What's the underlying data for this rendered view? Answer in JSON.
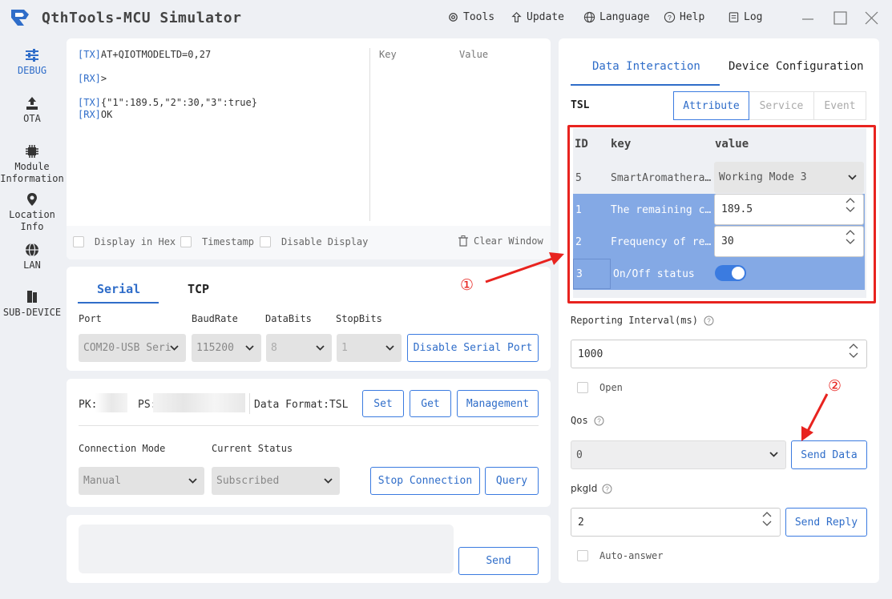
{
  "app": {
    "title": "QthTools-MCU Simulator"
  },
  "toolbar": {
    "tools": "Tools",
    "update": "Update",
    "language": "Language",
    "help": "Help",
    "log": "Log"
  },
  "sidebar": [
    {
      "label": "DEBUG",
      "icon": "sliders-icon"
    },
    {
      "label": "OTA",
      "icon": "upload-icon"
    },
    {
      "label": "Module Information",
      "icon": "chip-icon"
    },
    {
      "label": "Location Info",
      "icon": "location-pin-icon"
    },
    {
      "label": "LAN",
      "icon": "globe-icon"
    },
    {
      "label": "SUB-DEVICE",
      "icon": "device-icon"
    }
  ],
  "console": {
    "lines": [
      {
        "tag": "[TX]",
        "text": "AT+QIOTMODELTD=0,27"
      },
      {
        "tag": "[RX]",
        "text": ">"
      },
      {
        "tag": "[TX]",
        "text": "{\"1\":189.5,\"2\":30,\"3\":true}"
      },
      {
        "tag": "[RX]",
        "text": "OK"
      }
    ],
    "key_header": "Key",
    "value_header": "Value",
    "display_hex": "Display in Hex",
    "timestamp": "Timestamp",
    "disable_display": "Disable Display",
    "clear_window": "Clear Window"
  },
  "serial": {
    "tab_serial": "Serial",
    "tab_tcp": "TCP",
    "port_label": "Port",
    "baud_label": "BaudRate",
    "databits_label": "DataBits",
    "stopbits_label": "StopBits",
    "port_value": "COM20-USB Seri",
    "baud_value": "115200",
    "databits_value": "8",
    "stopbits_value": "1",
    "disable_button": "Disable Serial Port"
  },
  "connection": {
    "pk_label": "PK:",
    "ps_label": "PS:",
    "data_format": "Data Format:TSL",
    "set": "Set",
    "get": "Get",
    "management": "Management",
    "mode_label": "Connection Mode",
    "status_label": "Current Status",
    "mode_value": "Manual",
    "status_value": "Subscribed",
    "stop_button": "Stop Connection",
    "query_button": "Query"
  },
  "send_box": {
    "send": "Send"
  },
  "right": {
    "tab_data": "Data Interaction",
    "tab_device": "Device Configuration",
    "tsl_label": "TSL",
    "subtab_attribute": "Attribute",
    "subtab_service": "Service",
    "subtab_event": "Event",
    "table_headers": {
      "id": "ID",
      "key": "key",
      "value": "value"
    },
    "rows": [
      {
        "id": "5",
        "key": "SmartAromathera…",
        "value": "Working Mode 3"
      },
      {
        "id": "1",
        "key": "The remaining c…",
        "value": "189.5"
      },
      {
        "id": "2",
        "key": "Frequency of re…",
        "value": "30"
      },
      {
        "id": "3",
        "key": "On/Off status",
        "value": ""
      }
    ],
    "reporting_label": "Reporting Interval(ms)",
    "reporting_value": "1000",
    "open_label": "Open",
    "qos_label": "Qos",
    "qos_value": "0",
    "send_data": "Send Data",
    "pkgid_label": "pkgId",
    "pkgid_value": "2",
    "send_reply": "Send Reply",
    "auto_answer": "Auto-answer"
  },
  "annotations": {
    "one": "①",
    "two": "②"
  },
  "colors": {
    "accent": "#2f6dc9",
    "selected_row": "#84a9e5",
    "highlight_box": "#e8231f"
  }
}
